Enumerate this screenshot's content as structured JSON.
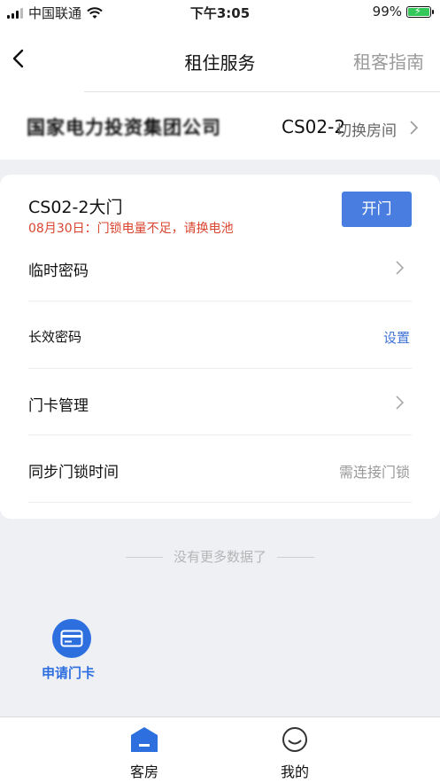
{
  "status_bar": {
    "carrier": "中国联通",
    "time": "下午3:05",
    "battery": "99%"
  },
  "header": {
    "title": "租住服务",
    "right_link": "租客指南"
  },
  "room": {
    "name": "国家电力投资集团公司",
    "code": "CS02-2",
    "switch_label": "切换房间"
  },
  "door": {
    "title": "CS02-2大门",
    "warning": "08月30日：门锁电量不足，请换电池",
    "open_label": "开门"
  },
  "rows": [
    {
      "label": "临时密码",
      "right": ""
    },
    {
      "label": "长效密码",
      "right": "设置"
    },
    {
      "label": "门卡管理",
      "right": ""
    },
    {
      "label": "同步门锁时间",
      "right": "需连接门锁"
    }
  ],
  "footer_note": "没有更多数据了",
  "apply_card": {
    "label": "申请门卡"
  },
  "tabs": [
    {
      "label": "客房",
      "active": true
    },
    {
      "label": "我的",
      "active": false
    }
  ],
  "colors": {
    "accent": "#4a7de0",
    "warning": "#d9452f",
    "link": "#3f73d8"
  }
}
